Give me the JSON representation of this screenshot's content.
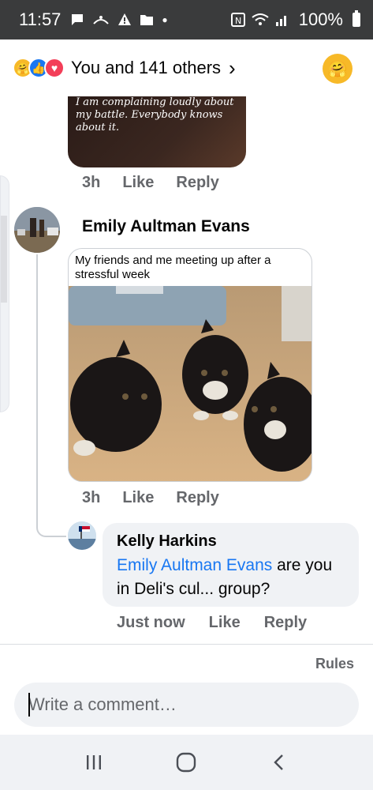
{
  "status_bar": {
    "time": "11:57",
    "battery": "100%"
  },
  "reactions": {
    "summary": "You and 141 others",
    "icons": [
      "care-icon",
      "like-icon",
      "love-icon"
    ]
  },
  "previous_comment": {
    "image_caption": "I am complaining loudly about my battle. Everybody knows about it.",
    "time": "3h",
    "like_label": "Like",
    "reply_label": "Reply"
  },
  "emily_comment": {
    "name": "Emily Aultman Evans",
    "gif_caption": "My friends and me meeting up after a stressful week",
    "time": "3h",
    "like_label": "Like",
    "reply_label": "Reply"
  },
  "kelly_reply": {
    "name": "Kelly Harkins",
    "mention": "Emily Aultman Evans",
    "text": " are you in Deli's cul... group?",
    "time": "Just now",
    "like_label": "Like",
    "reply_label": "Reply"
  },
  "rules_label": "Rules",
  "comment_box": {
    "placeholder": "Write a comment…"
  },
  "colors": {
    "accent": "#1877f2",
    "status_bar": "#3a3b3c",
    "bubble": "#f0f2f5",
    "secondary_text": "#65676b"
  }
}
